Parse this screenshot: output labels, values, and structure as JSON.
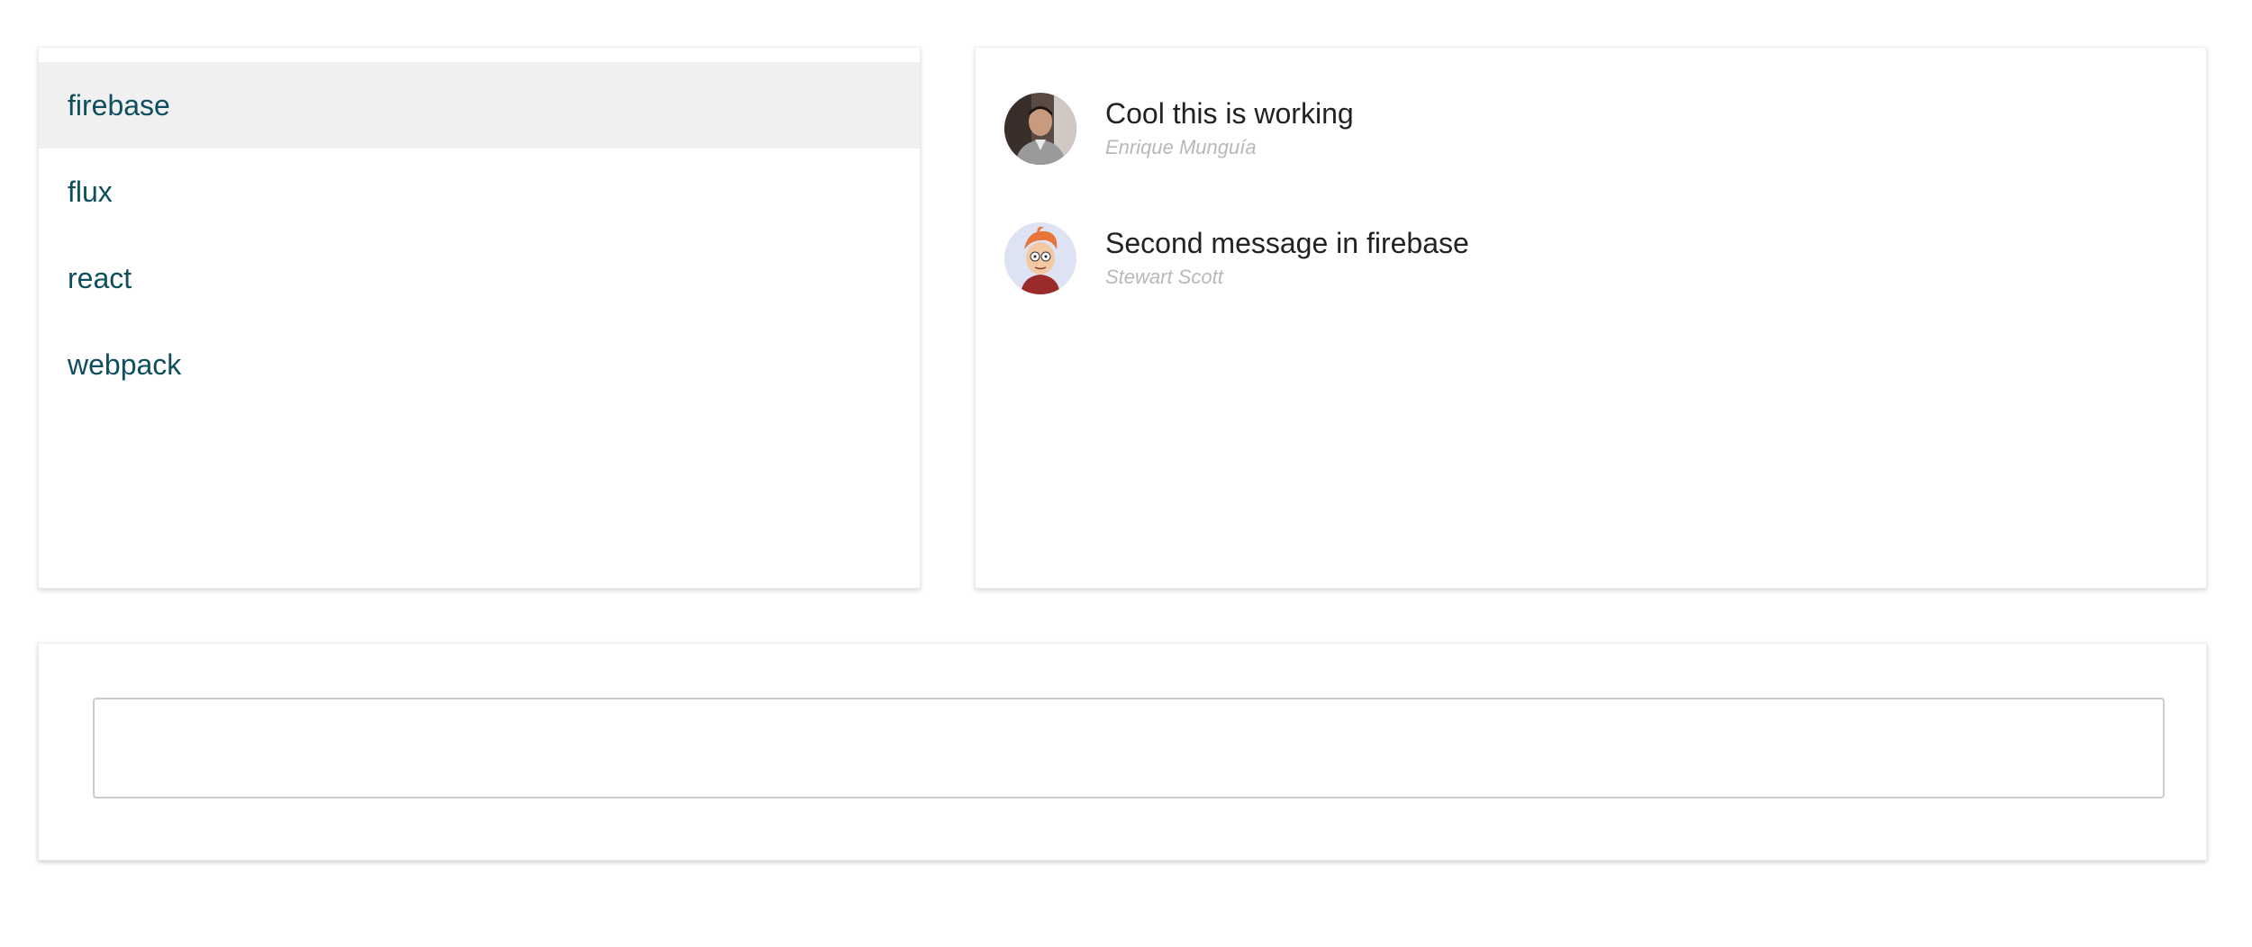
{
  "channels": [
    {
      "label": "firebase",
      "selected": true
    },
    {
      "label": "flux",
      "selected": false
    },
    {
      "label": "react",
      "selected": false
    },
    {
      "label": "webpack",
      "selected": false
    }
  ],
  "messages": [
    {
      "text": "Cool this is working",
      "author": "Enrique Munguía",
      "avatar_icon": "user-photo-avatar"
    },
    {
      "text": "Second message in firebase",
      "author": "Stewart Scott",
      "avatar_icon": "cartoon-character-avatar"
    }
  ],
  "compose": {
    "value": "",
    "placeholder": ""
  },
  "colors": {
    "channel_text": "#0e4e5f",
    "selected_bg": "#f0f0f0",
    "author_text": "#b8b8b8"
  }
}
